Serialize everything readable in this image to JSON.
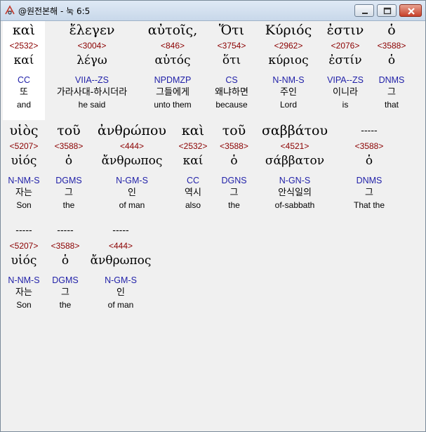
{
  "window": {
    "title": "@원전본해 - 눅 6:5"
  },
  "rows": [
    [
      {
        "greek": "καὶ",
        "strong": "<2532>",
        "lemma": "καί",
        "parse": "CC",
        "korean": "또",
        "english": "and"
      },
      {
        "greek": "ἔλεγεν",
        "strong": "<3004>",
        "lemma": "λέγω",
        "parse": "VIIA--ZS",
        "korean": "가라사대-하시더라",
        "english": "he said"
      },
      {
        "greek": "αὐτοῖς,",
        "strong": "<846>",
        "lemma": "αὐτός",
        "parse": "NPDMZP",
        "korean": "그들에게",
        "english": "unto them"
      },
      {
        "greek": "Ὅτι",
        "strong": "<3754>",
        "lemma": "ὅτι",
        "parse": "CS",
        "korean": "왜냐하면",
        "english": "because"
      },
      {
        "greek": "Κύριός",
        "strong": "<2962>",
        "lemma": "κύριος",
        "parse": "N-NM-S",
        "korean": "주인",
        "english": "Lord"
      },
      {
        "greek": "ἐστιν",
        "strong": "<2076>",
        "lemma": "ἐστίν",
        "parse": "VIPA--ZS",
        "korean": "이니라",
        "english": "is"
      },
      {
        "greek": "ὁ",
        "strong": "<3588>",
        "lemma": "ὁ",
        "parse": "DNMS",
        "korean": "그",
        "english": "that"
      }
    ],
    [
      {
        "greek": "υἱὸς",
        "strong": "<5207>",
        "lemma": "υἱός",
        "parse": "N-NM-S",
        "korean": "자는",
        "english": "Son"
      },
      {
        "greek": "τοῦ",
        "strong": "<3588>",
        "lemma": "ὁ",
        "parse": "DGMS",
        "korean": "그",
        "english": "the"
      },
      {
        "greek": "ἀνθρώπου",
        "strong": "<444>",
        "lemma": "ἄνθρωπος",
        "parse": "N-GM-S",
        "korean": "인",
        "english": "of man"
      },
      {
        "greek": "καὶ",
        "strong": "<2532>",
        "lemma": "καί",
        "parse": "CC",
        "korean": "역시",
        "english": "also"
      },
      {
        "greek": "τοῦ",
        "strong": "<3588>",
        "lemma": "ὁ",
        "parse": "DGNS",
        "korean": "그",
        "english": "the"
      },
      {
        "greek": "σαββάτου",
        "strong": "<4521>",
        "lemma": "σάββατον",
        "parse": "N-GN-S",
        "korean": "안식일의",
        "english": "of-sabbath"
      },
      {
        "greek": "-----",
        "strong": "<3588>",
        "lemma": "ὁ",
        "parse": "DNMS",
        "korean": "그",
        "english": "That the"
      }
    ],
    [
      {
        "greek": "-----",
        "strong": "<5207>",
        "lemma": "υἱός",
        "parse": "N-NM-S",
        "korean": "자는",
        "english": "Son"
      },
      {
        "greek": "-----",
        "strong": "<3588>",
        "lemma": "ὁ",
        "parse": "DGMS",
        "korean": "그",
        "english": "the"
      },
      {
        "greek": "-----",
        "strong": "<444>",
        "lemma": "ἄνθρωπος",
        "parse": "N-GM-S",
        "korean": "인",
        "english": "of man"
      }
    ]
  ]
}
